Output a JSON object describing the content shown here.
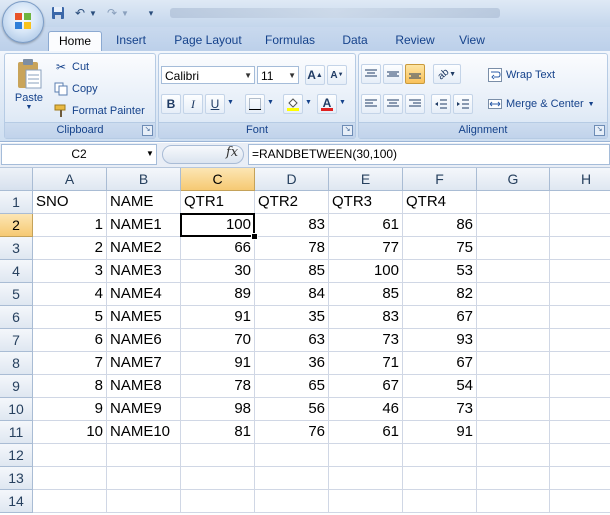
{
  "title_bar": {
    "qat_icons": [
      "save-icon",
      "undo-icon",
      "redo-icon"
    ]
  },
  "tabs": [
    "Home",
    "Insert",
    "Page Layout",
    "Formulas",
    "Data",
    "Review",
    "View"
  ],
  "ribbon": {
    "clipboard": {
      "paste": "Paste",
      "cut": "Cut",
      "copy": "Copy",
      "format_painter": "Format Painter",
      "label": "Clipboard"
    },
    "font": {
      "font_name": "Calibri",
      "font_size": "11",
      "label": "Font",
      "bold": "B",
      "italic": "I",
      "underline": "U",
      "font_color": "A"
    },
    "alignment": {
      "wrap_text": "Wrap Text",
      "merge_center": "Merge & Center",
      "label": "Alignment"
    }
  },
  "formula_bar": {
    "name_box": "C2",
    "fx": "fx",
    "formula": "=RANDBETWEEN(30,100)"
  },
  "grid": {
    "columns": [
      "A",
      "B",
      "C",
      "D",
      "E",
      "F",
      "G",
      "H"
    ],
    "rows": [
      "1",
      "2",
      "3",
      "4",
      "5",
      "6",
      "7",
      "8",
      "9",
      "10",
      "11",
      "12",
      "13",
      "14"
    ],
    "selected_cell": "C2",
    "data": [
      [
        "SNO",
        "NAME",
        "QTR1",
        "QTR2",
        "QTR3",
        "QTR4"
      ],
      [
        "1",
        "NAME1",
        "100",
        "83",
        "61",
        "86"
      ],
      [
        "2",
        "NAME2",
        "66",
        "78",
        "77",
        "75"
      ],
      [
        "3",
        "NAME3",
        "30",
        "85",
        "100",
        "53"
      ],
      [
        "4",
        "NAME4",
        "89",
        "84",
        "85",
        "82"
      ],
      [
        "5",
        "NAME5",
        "91",
        "35",
        "83",
        "67"
      ],
      [
        "6",
        "NAME6",
        "70",
        "63",
        "73",
        "93"
      ],
      [
        "7",
        "NAME7",
        "91",
        "36",
        "71",
        "67"
      ],
      [
        "8",
        "NAME8",
        "78",
        "65",
        "67",
        "54"
      ],
      [
        "9",
        "NAME9",
        "98",
        "56",
        "46",
        "73"
      ],
      [
        "10",
        "NAME10",
        "81",
        "76",
        "61",
        "91"
      ]
    ]
  }
}
